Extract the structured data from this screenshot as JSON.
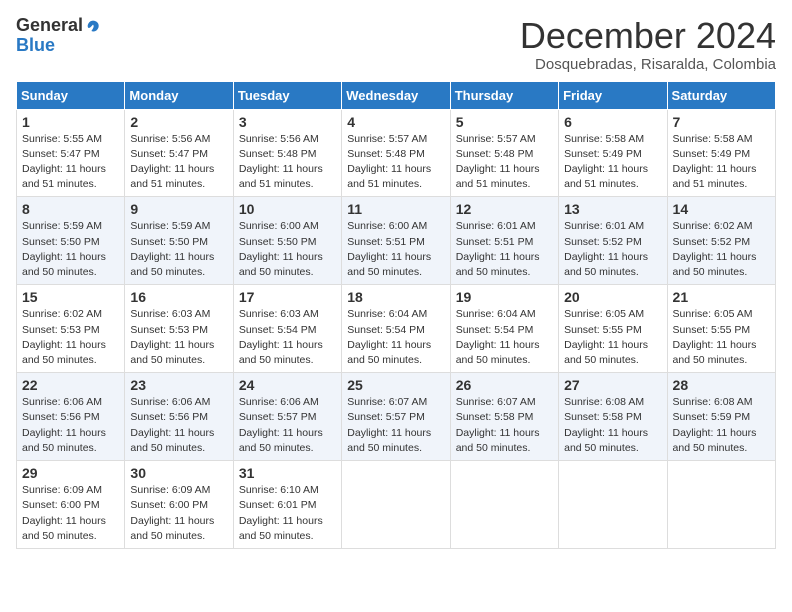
{
  "logo": {
    "general": "General",
    "blue": "Blue"
  },
  "title": "December 2024",
  "subtitle": "Dosquebradas, Risaralda, Colombia",
  "days_header": [
    "Sunday",
    "Monday",
    "Tuesday",
    "Wednesday",
    "Thursday",
    "Friday",
    "Saturday"
  ],
  "weeks": [
    [
      {
        "day": "1",
        "sunrise": "5:55 AM",
        "sunset": "5:47 PM",
        "daylight": "11 hours and 51 minutes."
      },
      {
        "day": "2",
        "sunrise": "5:56 AM",
        "sunset": "5:47 PM",
        "daylight": "11 hours and 51 minutes."
      },
      {
        "day": "3",
        "sunrise": "5:56 AM",
        "sunset": "5:48 PM",
        "daylight": "11 hours and 51 minutes."
      },
      {
        "day": "4",
        "sunrise": "5:57 AM",
        "sunset": "5:48 PM",
        "daylight": "11 hours and 51 minutes."
      },
      {
        "day": "5",
        "sunrise": "5:57 AM",
        "sunset": "5:48 PM",
        "daylight": "11 hours and 51 minutes."
      },
      {
        "day": "6",
        "sunrise": "5:58 AM",
        "sunset": "5:49 PM",
        "daylight": "11 hours and 51 minutes."
      },
      {
        "day": "7",
        "sunrise": "5:58 AM",
        "sunset": "5:49 PM",
        "daylight": "11 hours and 51 minutes."
      }
    ],
    [
      {
        "day": "8",
        "sunrise": "5:59 AM",
        "sunset": "5:50 PM",
        "daylight": "11 hours and 50 minutes."
      },
      {
        "day": "9",
        "sunrise": "5:59 AM",
        "sunset": "5:50 PM",
        "daylight": "11 hours and 50 minutes."
      },
      {
        "day": "10",
        "sunrise": "6:00 AM",
        "sunset": "5:50 PM",
        "daylight": "11 hours and 50 minutes."
      },
      {
        "day": "11",
        "sunrise": "6:00 AM",
        "sunset": "5:51 PM",
        "daylight": "11 hours and 50 minutes."
      },
      {
        "day": "12",
        "sunrise": "6:01 AM",
        "sunset": "5:51 PM",
        "daylight": "11 hours and 50 minutes."
      },
      {
        "day": "13",
        "sunrise": "6:01 AM",
        "sunset": "5:52 PM",
        "daylight": "11 hours and 50 minutes."
      },
      {
        "day": "14",
        "sunrise": "6:02 AM",
        "sunset": "5:52 PM",
        "daylight": "11 hours and 50 minutes."
      }
    ],
    [
      {
        "day": "15",
        "sunrise": "6:02 AM",
        "sunset": "5:53 PM",
        "daylight": "11 hours and 50 minutes."
      },
      {
        "day": "16",
        "sunrise": "6:03 AM",
        "sunset": "5:53 PM",
        "daylight": "11 hours and 50 minutes."
      },
      {
        "day": "17",
        "sunrise": "6:03 AM",
        "sunset": "5:54 PM",
        "daylight": "11 hours and 50 minutes."
      },
      {
        "day": "18",
        "sunrise": "6:04 AM",
        "sunset": "5:54 PM",
        "daylight": "11 hours and 50 minutes."
      },
      {
        "day": "19",
        "sunrise": "6:04 AM",
        "sunset": "5:54 PM",
        "daylight": "11 hours and 50 minutes."
      },
      {
        "day": "20",
        "sunrise": "6:05 AM",
        "sunset": "5:55 PM",
        "daylight": "11 hours and 50 minutes."
      },
      {
        "day": "21",
        "sunrise": "6:05 AM",
        "sunset": "5:55 PM",
        "daylight": "11 hours and 50 minutes."
      }
    ],
    [
      {
        "day": "22",
        "sunrise": "6:06 AM",
        "sunset": "5:56 PM",
        "daylight": "11 hours and 50 minutes."
      },
      {
        "day": "23",
        "sunrise": "6:06 AM",
        "sunset": "5:56 PM",
        "daylight": "11 hours and 50 minutes."
      },
      {
        "day": "24",
        "sunrise": "6:06 AM",
        "sunset": "5:57 PM",
        "daylight": "11 hours and 50 minutes."
      },
      {
        "day": "25",
        "sunrise": "6:07 AM",
        "sunset": "5:57 PM",
        "daylight": "11 hours and 50 minutes."
      },
      {
        "day": "26",
        "sunrise": "6:07 AM",
        "sunset": "5:58 PM",
        "daylight": "11 hours and 50 minutes."
      },
      {
        "day": "27",
        "sunrise": "6:08 AM",
        "sunset": "5:58 PM",
        "daylight": "11 hours and 50 minutes."
      },
      {
        "day": "28",
        "sunrise": "6:08 AM",
        "sunset": "5:59 PM",
        "daylight": "11 hours and 50 minutes."
      }
    ],
    [
      {
        "day": "29",
        "sunrise": "6:09 AM",
        "sunset": "6:00 PM",
        "daylight": "11 hours and 50 minutes."
      },
      {
        "day": "30",
        "sunrise": "6:09 AM",
        "sunset": "6:00 PM",
        "daylight": "11 hours and 50 minutes."
      },
      {
        "day": "31",
        "sunrise": "6:10 AM",
        "sunset": "6:01 PM",
        "daylight": "11 hours and 50 minutes."
      },
      null,
      null,
      null,
      null
    ]
  ]
}
